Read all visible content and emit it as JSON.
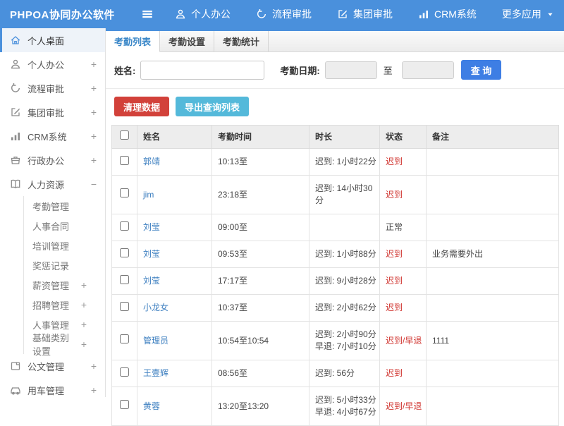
{
  "colors": {
    "topbar_blue": "#4a90dc",
    "active_tab_blue": "#3a87c8",
    "query_button_blue": "#3e7ee4",
    "danger_red": "#d2413a",
    "info_teal": "#54b9da",
    "status_alert_red": "#d0342f",
    "link_blue": "#3d7fc0"
  },
  "topbar": {
    "brand": "PHPOA协同办公软件",
    "items": [
      {
        "id": "personal-office",
        "label": "个人办公",
        "icon": "person-icon"
      },
      {
        "id": "workflow-approval",
        "label": "流程审批",
        "icon": "flow-icon"
      },
      {
        "id": "group-approval",
        "label": "集团审批",
        "icon": "edit-icon"
      },
      {
        "id": "crm-system",
        "label": "CRM系统",
        "icon": "chart-icon"
      },
      {
        "id": "more-apps",
        "label": "更多应用",
        "caret": true
      }
    ]
  },
  "sidebar": {
    "items": [
      {
        "id": "personal-desktop",
        "label": "个人桌面",
        "icon": "home-icon",
        "active": true
      },
      {
        "id": "personal-office",
        "label": "个人办公",
        "icon": "person-icon",
        "expand": "+"
      },
      {
        "id": "workflow-approval",
        "label": "流程审批",
        "icon": "flow-icon",
        "expand": "+"
      },
      {
        "id": "group-approval",
        "label": "集团审批",
        "icon": "edit-icon",
        "expand": "+"
      },
      {
        "id": "crm-system",
        "label": "CRM系统",
        "icon": "chart-icon",
        "expand": "+"
      },
      {
        "id": "admin-office",
        "label": "行政办公",
        "icon": "briefcase-icon",
        "expand": "+"
      },
      {
        "id": "human-resources",
        "label": "人力资源",
        "icon": "book-icon",
        "expand": "−"
      },
      {
        "id": "attendance-mgmt",
        "label": "考勤管理",
        "sub": true
      },
      {
        "id": "hr-contract",
        "label": "人事合同",
        "sub": true
      },
      {
        "id": "training-mgmt",
        "label": "培训管理",
        "sub": true
      },
      {
        "id": "reward-punishment",
        "label": "奖惩记录",
        "sub": true
      },
      {
        "id": "salary-mgmt",
        "label": "薪资管理",
        "sub": true,
        "expand": "+"
      },
      {
        "id": "recruitment-mgmt",
        "label": "招聘管理",
        "sub": true,
        "expand": "+"
      },
      {
        "id": "personnel-mgmt",
        "label": "人事管理",
        "sub": true,
        "expand": "+"
      },
      {
        "id": "base-category-settings",
        "label": "基础类别设置",
        "sub": true,
        "expand": "+"
      },
      {
        "id": "document-mgmt",
        "label": "公文管理",
        "icon": "doc-icon",
        "expand": "+"
      },
      {
        "id": "vehicle-mgmt",
        "label": "用车管理",
        "icon": "car-icon",
        "expand": "+"
      }
    ]
  },
  "tabs": [
    {
      "id": "attendance-list",
      "label": "考勤列表",
      "active": true
    },
    {
      "id": "attendance-settings",
      "label": "考勤设置",
      "active": false
    },
    {
      "id": "attendance-stats",
      "label": "考勤统计",
      "active": false
    }
  ],
  "filter": {
    "name_label": "姓名:",
    "name_value": "",
    "name_placeholder": "",
    "date_label": "考勤日期:",
    "date_from_value": "",
    "to_label": "至",
    "date_to_value": "",
    "search_button": "查 询"
  },
  "actions": {
    "clean_button": "清理数据",
    "export_button": "导出查询列表"
  },
  "table": {
    "columns": [
      "姓名",
      "考勤时间",
      "时长",
      "状态",
      "备注"
    ],
    "rows": [
      {
        "name": "郭靖",
        "time": "10:13至",
        "duration": [
          "迟到: 1小时22分"
        ],
        "status": "迟到",
        "alert": true,
        "note": ""
      },
      {
        "name": "jim",
        "time": "23:18至",
        "duration": [
          "迟到: 14小时30分"
        ],
        "status": "迟到",
        "alert": true,
        "note": ""
      },
      {
        "name": "刘莹",
        "time": "09:00至",
        "duration": [],
        "status": "正常",
        "alert": false,
        "note": ""
      },
      {
        "name": "刘莹",
        "time": "09:53至",
        "duration": [
          "迟到: 1小时88分"
        ],
        "status": "迟到",
        "alert": true,
        "note": "业务需要外出"
      },
      {
        "name": "刘莹",
        "time": "17:17至",
        "duration": [
          "迟到: 9小时28分"
        ],
        "status": "迟到",
        "alert": true,
        "note": ""
      },
      {
        "name": "小龙女",
        "time": "10:37至",
        "duration": [
          "迟到: 2小时62分"
        ],
        "status": "迟到",
        "alert": true,
        "note": ""
      },
      {
        "name": "管理员",
        "time": "10:54至10:54",
        "duration": [
          "迟到: 2小时90分",
          "早退: 7小时10分"
        ],
        "status": "迟到/早退",
        "alert": true,
        "note": "1111"
      },
      {
        "name": "王壹辉",
        "time": "08:56至",
        "duration": [
          "迟到: 56分"
        ],
        "status": "迟到",
        "alert": true,
        "note": ""
      },
      {
        "name": "黄蓉",
        "time": "13:20至13:20",
        "duration": [
          "迟到: 5小时33分",
          "早退: 4小时67分"
        ],
        "status": "迟到/早退",
        "alert": true,
        "note": ""
      }
    ]
  }
}
